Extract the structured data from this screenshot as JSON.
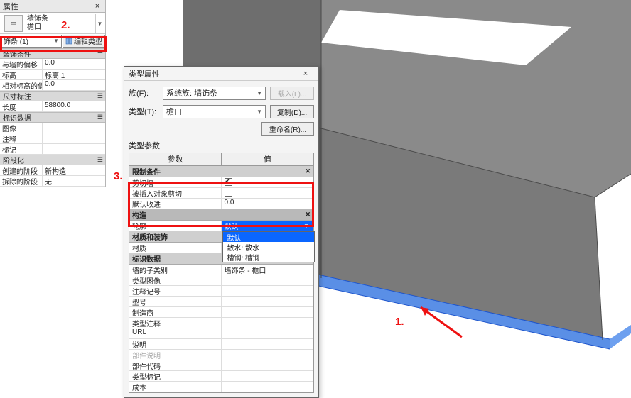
{
  "annotations": {
    "n1": "1.",
    "n2": "2.",
    "n3": "3."
  },
  "properties_panel": {
    "title": "属性",
    "close": "×",
    "type_selector_l1": "墙饰条",
    "type_selector_l2": "檐口",
    "instance_dropdown": "饰条 (1)",
    "edit_type_btn": "编辑类型",
    "categories": [
      {
        "name": "装饰条件",
        "rows": [
          {
            "n": "与墙的偏移",
            "v": "0.0"
          },
          {
            "n": "标高",
            "v": "标高 1"
          },
          {
            "n": "相对标高的偏移",
            "v": "0.0"
          }
        ]
      },
      {
        "name": "尺寸标注",
        "rows": [
          {
            "n": "长度",
            "v": "58800.0"
          }
        ]
      },
      {
        "name": "标识数据",
        "rows": [
          {
            "n": "图像",
            "v": ""
          },
          {
            "n": "注释",
            "v": ""
          },
          {
            "n": "标记",
            "v": ""
          }
        ]
      },
      {
        "name": "阶段化",
        "rows": [
          {
            "n": "创建的阶段",
            "v": "新构造"
          },
          {
            "n": "拆除的阶段",
            "v": "无"
          }
        ]
      }
    ]
  },
  "type_dialog": {
    "title": "类型属性",
    "close": "×",
    "family_label": "族(F):",
    "family_value": "系统族: 墙饰条",
    "load_btn": "载入(L)...",
    "type_label": "类型(T):",
    "type_value": "檐口",
    "dup_btn": "复制(D)...",
    "rename_btn": "重命名(R)...",
    "type_params_label": "类型参数",
    "col_param": "参数",
    "col_value": "值",
    "groups": [
      {
        "name": "限制条件",
        "rows": [
          {
            "n": "剪切墙",
            "v": "chk_on"
          },
          {
            "n": "被插入对象剪切",
            "v": "chk_off"
          },
          {
            "n": "默认收进",
            "v": "0.0"
          }
        ]
      },
      {
        "name": "构造",
        "current": true,
        "rows": [
          {
            "n": "轮廓",
            "v": "默认",
            "dropdown": true
          }
        ]
      },
      {
        "name": "材质和装饰",
        "rows": [
          {
            "n": "材质",
            "v": ""
          }
        ]
      },
      {
        "name": "标识数据",
        "rows": [
          {
            "n": "墙的子类别",
            "v": "墙饰条 - 檐口"
          },
          {
            "n": "类型图像",
            "v": ""
          },
          {
            "n": "注释记号",
            "v": ""
          },
          {
            "n": "型号",
            "v": ""
          },
          {
            "n": "制造商",
            "v": ""
          },
          {
            "n": "类型注释",
            "v": ""
          },
          {
            "n": "URL",
            "v": ""
          },
          {
            "n": "说明",
            "v": ""
          },
          {
            "n": "部件说明",
            "v": "",
            "gray": true
          },
          {
            "n": "部件代码",
            "v": ""
          },
          {
            "n": "类型标记",
            "v": ""
          },
          {
            "n": "成本",
            "v": ""
          }
        ]
      }
    ],
    "dropdown_options": [
      {
        "label": "默认",
        "sel": true
      },
      {
        "label": "散水: 散水"
      },
      {
        "label": "槽钢: 槽钢"
      }
    ]
  }
}
